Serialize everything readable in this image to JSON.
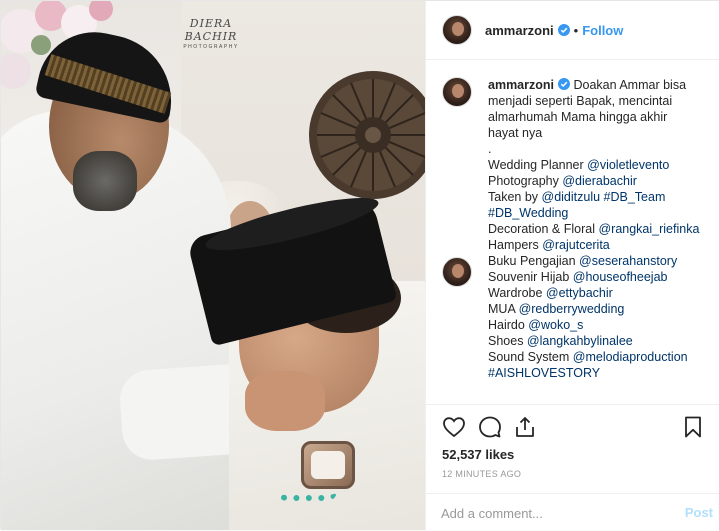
{
  "photo": {
    "watermark_title": "DIERA BACHIR",
    "watermark_sub": "PHOTOGRAPHY"
  },
  "header": {
    "username": "ammarzoni",
    "separator": "•",
    "follow_label": "Follow"
  },
  "caption": {
    "username": "ammarzoni",
    "lines": [
      {
        "text": " Doakan Ammar bisa"
      },
      {
        "text": "menjadi seperti Bapak, mencintai"
      },
      {
        "text": "almarhumah Mama hingga akhir"
      },
      {
        "text": "hayat nya"
      },
      {
        "text": "."
      },
      {
        "prefix": "Wedding Planner ",
        "mention": "@violetlevento"
      },
      {
        "prefix": "Photography ",
        "mention": "@dierabachir"
      },
      {
        "prefix": "Taken by ",
        "mention": "@diditzulu #DB_Team"
      },
      {
        "prefix": "",
        "mention": "#DB_Wedding"
      },
      {
        "prefix": "Decoration & Floral ",
        "mention": "@rangkai_riefinka"
      },
      {
        "prefix": "Hampers ",
        "mention": "@rajutcerita"
      },
      {
        "prefix": "Buku Pengajian ",
        "mention": "@seserahanstory"
      },
      {
        "prefix": "Souvenir Hijab ",
        "mention": "@houseofheejab"
      },
      {
        "prefix": "Wardrobe ",
        "mention": "@ettybachir"
      },
      {
        "prefix": "MUA ",
        "mention": "@redberrywedding"
      },
      {
        "prefix": "Hairdo ",
        "mention": "@woko_s"
      },
      {
        "prefix": "Shoes ",
        "mention": "@langkahbylinalee"
      },
      {
        "prefix": "Sound System ",
        "mention": "@melodiaproduction"
      },
      {
        "text": " "
      },
      {
        "prefix": "",
        "mention": "#AISHLOVESTORY"
      }
    ]
  },
  "actions": {
    "icons": [
      "heart-icon",
      "comment-icon",
      "share-icon",
      "bookmark-icon"
    ],
    "likes": "52,537 likes",
    "time": "12 MINUTES AGO"
  },
  "add_comment": {
    "placeholder": "Add a comment...",
    "post_label": "Post"
  },
  "colors": {
    "link": "#3897f0",
    "mention": "#003569",
    "verified": "#3897f0",
    "post_disabled": "#b2dffc"
  }
}
